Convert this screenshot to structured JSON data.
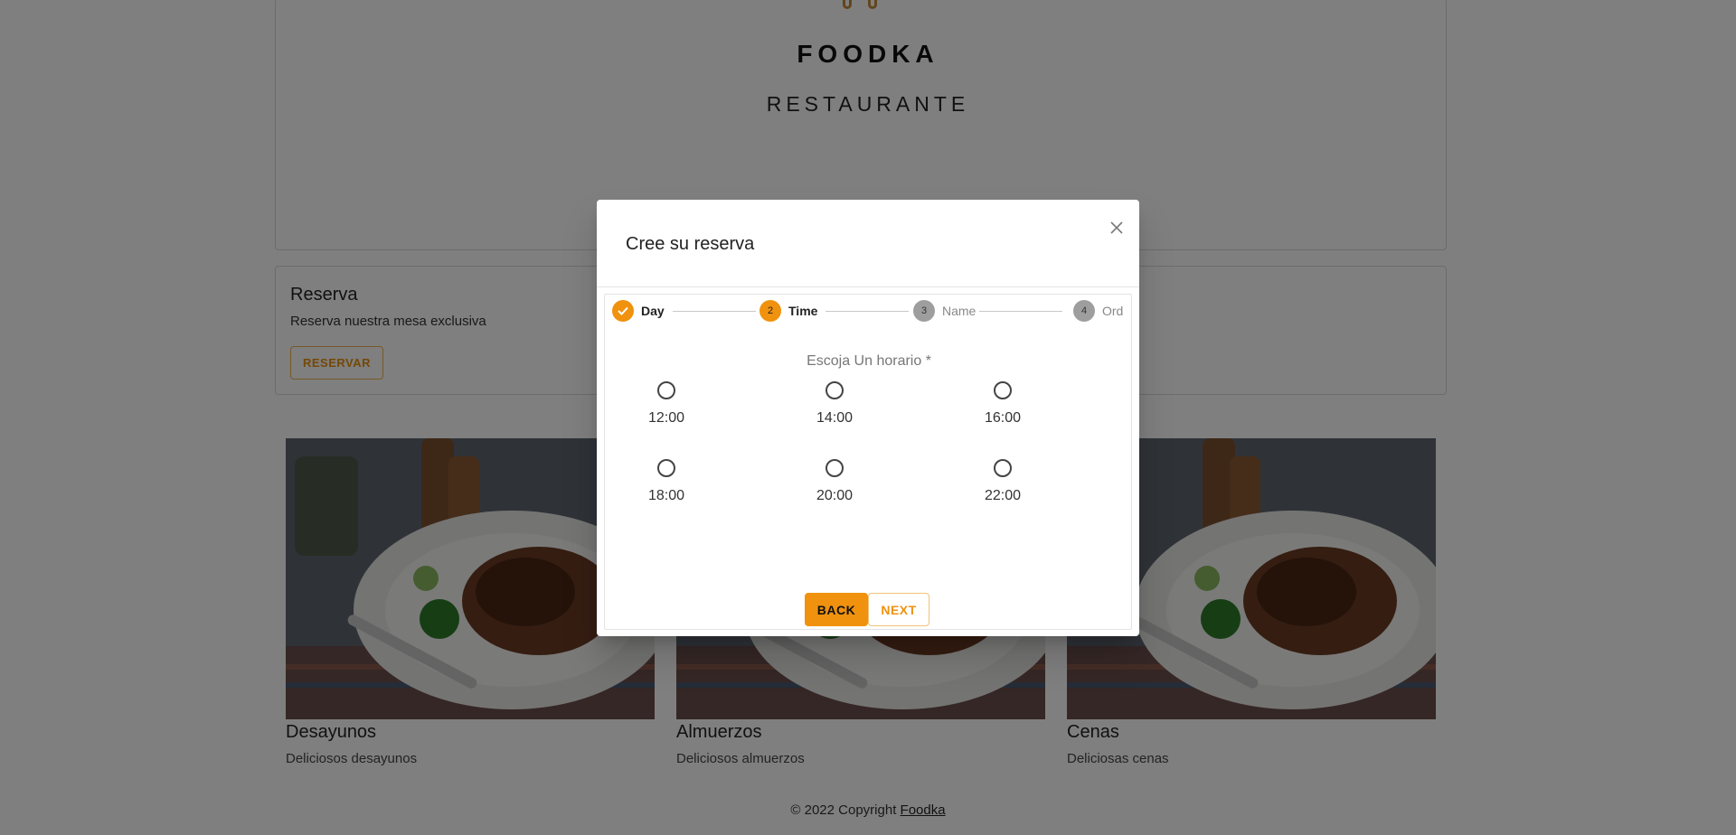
{
  "brand": {
    "name": "FOODKA",
    "tagline": "RESTAURANTE"
  },
  "reserve": {
    "title": "Reserva",
    "text": "Reserva nuestra mesa exclusiva",
    "button": "RESERVAR"
  },
  "menu": [
    {
      "title": "Desayunos",
      "desc": "Deliciosos desayunos"
    },
    {
      "title": "Almuerzos",
      "desc": "Deliciosos almuerzos"
    },
    {
      "title": "Cenas",
      "desc": "Deliciosas cenas"
    }
  ],
  "footer": {
    "text": "© 2022 Copyright ",
    "link": "Foodka"
  },
  "dialog": {
    "title": "Cree su reserva",
    "close_icon": "close-icon",
    "steps": [
      {
        "label": "Day",
        "marker": "✓",
        "state": "completed"
      },
      {
        "label": "Time",
        "marker": "2",
        "state": "active"
      },
      {
        "label": "Name",
        "marker": "3",
        "state": "pending"
      },
      {
        "label": "Ord",
        "marker": "4",
        "state": "pending"
      }
    ],
    "prompt": "Escoja Un horario *",
    "times": [
      "12:00",
      "14:00",
      "16:00",
      "18:00",
      "20:00",
      "22:00"
    ],
    "back_label": "BACK",
    "next_label": "NEXT"
  },
  "colors": {
    "accent": "#f0920e",
    "inactive_step": "#9e9e9e",
    "overlay": "rgba(0,0,0,0.5)"
  }
}
